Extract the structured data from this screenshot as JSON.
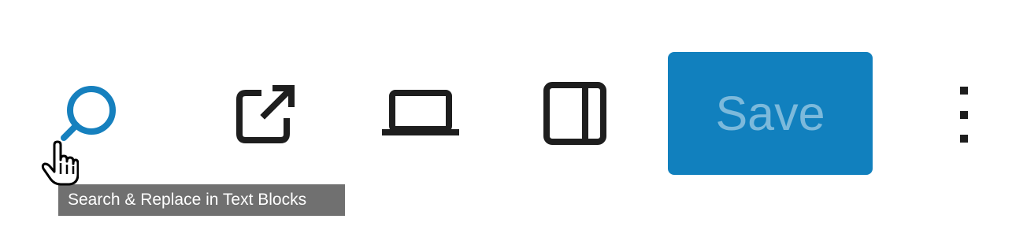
{
  "toolbar": {
    "icons": {
      "search": "search-icon",
      "external": "external-link-icon",
      "preview": "laptop-icon",
      "sidebar": "sidebar-panel-icon",
      "more": "vertical-ellipsis-icon",
      "cursor": "hand-pointer-icon"
    },
    "save_label": "Save",
    "tooltip_text": "Search & Replace in Text Blocks"
  },
  "colors": {
    "accent": "#1180be",
    "icon": "#1e1e1e",
    "tooltip_bg": "#707070"
  }
}
